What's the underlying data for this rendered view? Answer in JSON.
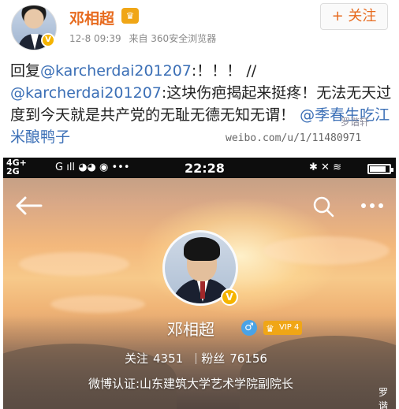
{
  "post": {
    "author": "邓相超",
    "timestamp": "12-8 09:39",
    "source": "来自 360安全浏览器",
    "follow_label": "+ 关注",
    "reply_prefix": "回复",
    "mention_1": "@karcherdai201207",
    "text_1": ":！！！ //",
    "mention_2": "@karcherdai201207",
    "text_2": ":这块伤疤揭起来挺疼！无法无天过度到今天就是共产党的无耻无德无知无谓！",
    "mention_3": "@季春生吃江米酿鸭子",
    "watermark_url": "weibo.com/u/1/11480971",
    "watermark_stamp": "罗谐轩"
  },
  "status_bar": {
    "network": "4G+",
    "network2": "2G",
    "carrier_icons": "G ıll",
    "time": "22:28",
    "battery_level": 0.82
  },
  "profile": {
    "name": "邓相超",
    "vip_label": "VIP 4",
    "following_label": "关注",
    "following_count": "4351",
    "followers_label": "粉丝",
    "followers_count": "76156",
    "verification": "微博认证:山东建筑大学艺术学院副院长",
    "credit": "罗谐轩"
  },
  "colors": {
    "name_orange": "#e76b1f",
    "mention_blue": "#3b6fb6",
    "vip_gold": "#f0a616",
    "verified_badge": "#f5b400"
  }
}
